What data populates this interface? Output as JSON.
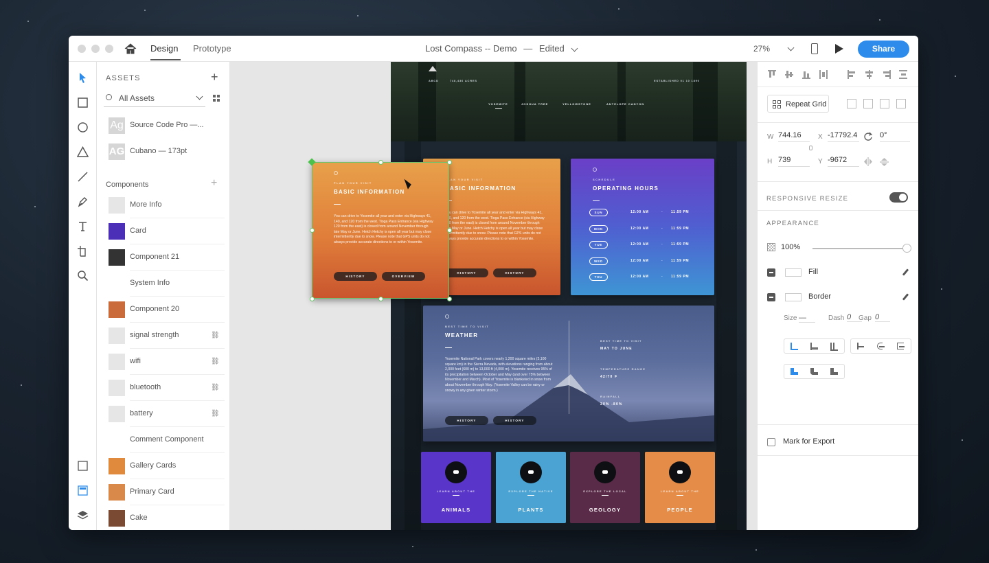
{
  "titlebar": {
    "tabs": [
      "Design",
      "Prototype"
    ],
    "document_title": "Lost Compass -- Demo",
    "document_separator": "—",
    "document_status": "Edited",
    "zoom": "27%",
    "share_label": "Share"
  },
  "assets": {
    "title": "ASSETS",
    "filter": "All Assets",
    "character_styles": [
      {
        "label": "Source Code Pro —...",
        "thumb": "Ag"
      },
      {
        "label": "Cubano — 173pt",
        "thumb": "AG"
      }
    ],
    "components_title": "Components",
    "components": [
      {
        "label": "More Info",
        "thumb_color": "#e6e6e6",
        "linked": false
      },
      {
        "label": "Card",
        "thumb_color": "#4b2fb6",
        "linked": false
      },
      {
        "label": "Component 21",
        "thumb_color": "#333333",
        "linked": false
      },
      {
        "label": "System Info",
        "thumb_color": "#ffffff",
        "linked": false
      },
      {
        "label": "Component 20",
        "thumb_color": "#c96b3a",
        "linked": false
      },
      {
        "label": "signal strength",
        "thumb_color": "#e6e6e6",
        "linked": true
      },
      {
        "label": "wifi",
        "thumb_color": "#e6e6e6",
        "linked": true
      },
      {
        "label": "bluetooth",
        "thumb_color": "#e6e6e6",
        "linked": true
      },
      {
        "label": "battery",
        "thumb_color": "#e6e6e6",
        "linked": true
      },
      {
        "label": "Comment Component",
        "thumb_color": "#ffffff",
        "linked": false
      },
      {
        "label": "Gallery Cards",
        "thumb_color": "#e08a3e",
        "linked": false
      },
      {
        "label": "Primary Card",
        "thumb_color": "#d98a4a",
        "linked": false
      },
      {
        "label": "Cake",
        "thumb_color": "#7a4a32",
        "linked": false
      }
    ]
  },
  "artboard": {
    "meta_left_a": "ABCD",
    "meta_left_b": "748,436 ACRES",
    "meta_right": "ESTABLISHED 01 10 1890",
    "nav": [
      "YOSEMITE",
      "JOSHUA TREE",
      "YELLOWSTONE",
      "ANTELOPE CANYON"
    ],
    "info_card": {
      "kicker": "PLAN YOUR VISIT",
      "title": "BASIC INFORMATION",
      "body": "You can drive to Yosemite all year and enter via Highways 41, 140, and 120 from the west. Tioga Pass Entrance (via Highway 120 from the east) is closed from around November through late May or June. Hetch Hetchy is open all year but may close intermittently due to snow. Please note that GPS units do not always provide accurate directions to or within Yosemite.",
      "btn1": "HISTORY",
      "btn2": "HISTORY"
    },
    "selected_card": {
      "kicker": "PLAN YOUR VISIT",
      "title": "BASIC INFORMATION",
      "body": "You can drive to Yosemite all year and enter via Highways 41, 140, and 120 from the west. Tioga Pass Entrance (via Highway 120 from the east) is closed from around November through late May or June. Hetch Hetchy is open all year but may close intermittently due to snow. Please note that GPS units do not always provide accurate directions to or within Yosemite.",
      "btn1": "HISTORY",
      "btn2": "OVERVIEW"
    },
    "hours_card": {
      "kicker": "SCHEDULE",
      "title": "OPERATING HOURS",
      "rows": [
        {
          "day": "SUN",
          "open": "12:00 AM",
          "dash": "-",
          "close": "11:59 PM"
        },
        {
          "day": "MON",
          "open": "12:00 AM",
          "dash": "-",
          "close": "11:59 PM"
        },
        {
          "day": "TUE",
          "open": "12:00 AM",
          "dash": "-",
          "close": "11:59 PM"
        },
        {
          "day": "WED",
          "open": "12:00 AM",
          "dash": "-",
          "close": "11:59 PM"
        },
        {
          "day": "THU",
          "open": "12:00 AM",
          "dash": "-",
          "close": "11:59 PM"
        }
      ]
    },
    "weather_card": {
      "kicker": "BEST TIME TO VISIT",
      "title": "WEATHER",
      "body": "Yosemite National Park covers nearly 1,200 square miles (3,100 square km) in the Sierra Nevada, with elevations ranging from about 2,000 feet (600 m) to 13,000 ft (4,000 m). Yosemite receives 95% of its precipitation between October and May (and over 75% between November and March). Most of Yosemite is blanketed in snow from about November through May. (Yosemite Valley can be rainy or snowy in any given winter storm.)",
      "btn1": "HISTORY",
      "btn2": "HISTORY",
      "stat1_k": "BEST TIME TO VISIT",
      "stat1_v": "MAY TO JUNE",
      "stat2_k": "TEMPERATURE RANGE",
      "stat2_v": "42/70 F",
      "stat3_k": "RAINFALL",
      "stat3_v": "20% -80%"
    },
    "tiles": [
      {
        "kicker": "LEARN ABOUT THE",
        "title": "ANIMALS",
        "color": "#5a35c9"
      },
      {
        "kicker": "EXPLORE THE NATIVE",
        "title": "PLANTS",
        "color": "#4aa3d2"
      },
      {
        "kicker": "EXPLORE THE LOCAL",
        "title": "GEOLOGY",
        "color": "#5a2b48"
      },
      {
        "kicker": "LEARN ABOUT THE",
        "title": "PEOPLE",
        "color": "#e58d48"
      }
    ]
  },
  "properties": {
    "repeat_grid": "Repeat Grid",
    "w_label": "W",
    "w": "744.16",
    "x_label": "X",
    "x": "-17792.4",
    "rot": "0°",
    "h_label": "H",
    "h": "739",
    "y_label": "Y",
    "y": "-9672",
    "responsive_resize": "RESPONSIVE RESIZE",
    "responsive_on": true,
    "appearance": "APPEARANCE",
    "opacity": "100%",
    "opacity_level": 1.0,
    "fill": "Fill",
    "border": "Border",
    "size_label": "Size",
    "size_value": "—",
    "dash_label": "Dash",
    "dash_value": "0",
    "gap_label": "Gap",
    "gap_value": "0",
    "mark_for_export": "Mark for Export"
  },
  "colors": {
    "accent": "#2d8ceb",
    "selection": "#6cc36c"
  }
}
